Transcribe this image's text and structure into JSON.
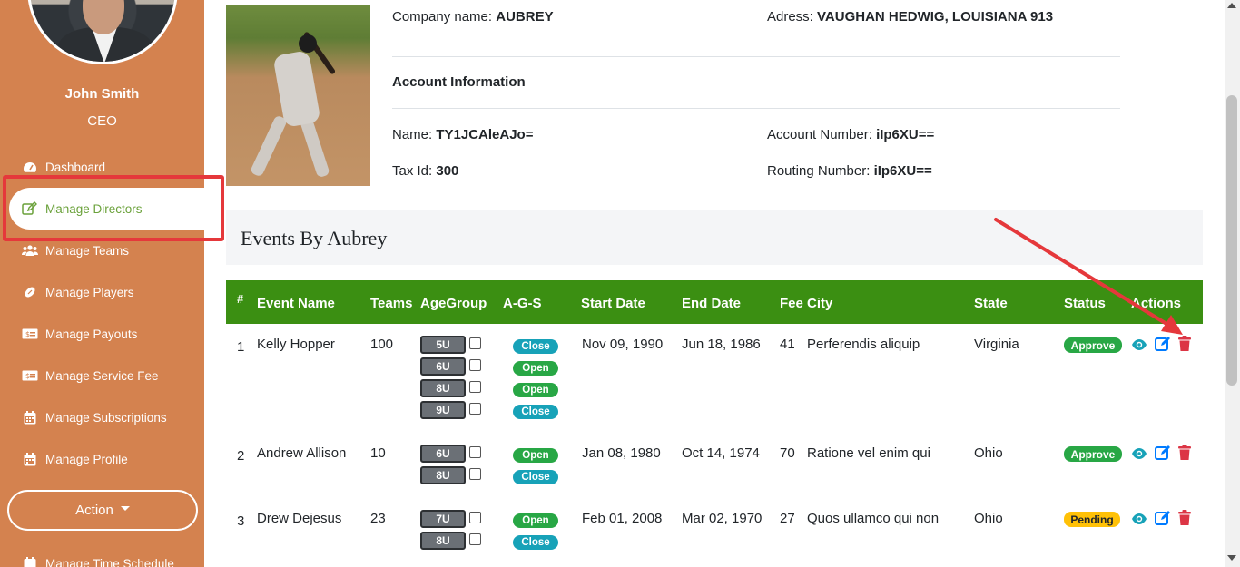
{
  "sidebar": {
    "user_name": "John Smith",
    "user_role": "CEO",
    "items": [
      {
        "label": "Dashboard",
        "icon": "tachometer-icon"
      },
      {
        "label": "Manage Directors",
        "icon": "edit-icon",
        "active": true
      },
      {
        "label": "Manage Teams",
        "icon": "users-icon"
      },
      {
        "label": "Manage Players",
        "icon": "football-icon"
      },
      {
        "label": "Manage Payouts",
        "icon": "money-bill-icon"
      },
      {
        "label": "Manage Service Fee",
        "icon": "money-bill-icon"
      },
      {
        "label": "Manage Subscriptions",
        "icon": "calendar-icon"
      },
      {
        "label": "Manage Profile",
        "icon": "calendar-icon"
      },
      {
        "label": "Manage Time Schedule",
        "icon": "calendar-icon"
      }
    ],
    "action_label": "Action",
    "bg_color": "#d4824f",
    "active_color": "#6aa13a"
  },
  "profile": {
    "company_label": "Company name:",
    "company_value": "AUBREY",
    "address_label": "Adress:",
    "address_value": "VAUGHAN HEDWIG, LOUISIANA 913",
    "account_heading": "Account Information",
    "name_label": "Name:",
    "name_value": "TY1JCAleAJo=",
    "account_number_label": "Account Number:",
    "account_number_value": "iIp6XU==",
    "tax_id_label": "Tax Id:",
    "tax_id_value": "300",
    "routing_number_label": "Routing Number:",
    "routing_number_value": "iIp6XU=="
  },
  "events": {
    "title": "Events By Aubrey",
    "header_color": "#3b8f12",
    "columns": [
      "#",
      "Event Name",
      "Teams",
      "AgeGroup",
      "A-G-S",
      "Start Date",
      "End Date",
      "Fee",
      "City",
      "State",
      "Status",
      "Actions"
    ],
    "rows": [
      {
        "num": "1",
        "name": "Kelly Hopper",
        "teams": "100",
        "age_groups": [
          "5U",
          "6U",
          "8U",
          "9U"
        ],
        "ags": [
          "Close",
          "Open",
          "Open",
          "Close"
        ],
        "start": "Nov 09, 1990",
        "end": "Jun 18, 1986",
        "fee": "41",
        "city": "Perferendis aliquip",
        "state": "Virginia",
        "status": "Approve"
      },
      {
        "num": "2",
        "name": "Andrew Allison",
        "teams": "10",
        "age_groups": [
          "6U",
          "8U"
        ],
        "ags": [
          "Open",
          "Close"
        ],
        "start": "Jan 08, 1980",
        "end": "Oct 14, 1974",
        "fee": "70",
        "city": "Ratione vel enim qui",
        "state": "Ohio",
        "status": "Approve"
      },
      {
        "num": "3",
        "name": "Drew Dejesus",
        "teams": "23",
        "age_groups": [
          "7U",
          "8U"
        ],
        "ags": [
          "Open",
          "Close"
        ],
        "start": "Feb 01, 2008",
        "end": "Mar 02, 1970",
        "fee": "27",
        "city": "Quos ullamco qui non",
        "state": "Ohio",
        "status": "Pending"
      }
    ]
  },
  "colors": {
    "approve": "#28a745",
    "pending": "#ffc107",
    "close": "#17a2b8",
    "open": "#28a745",
    "annotation": "#e5383b"
  }
}
